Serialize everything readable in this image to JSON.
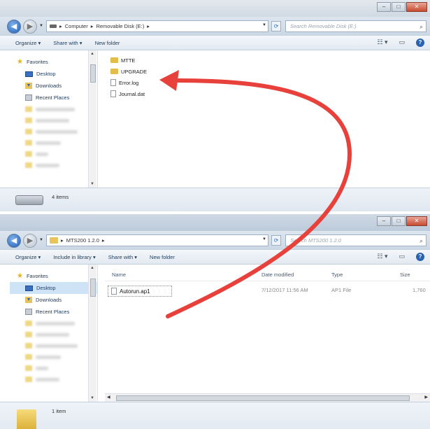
{
  "window1": {
    "address": {
      "segments": [
        "Computer",
        "Removable Disk (E:)"
      ]
    },
    "search_placeholder": "Search Removable Disk (E:)",
    "toolbar": {
      "organize": "Organize ▾",
      "share_with": "Share with ▾",
      "new_folder": "New folder"
    },
    "nav": {
      "favorites": "Favorites",
      "desktop": "Desktop",
      "downloads": "Downloads",
      "recent_places": "Recent Places"
    },
    "files": [
      {
        "name": "MTTE",
        "kind": "folder"
      },
      {
        "name": "UPGRADE",
        "kind": "folder"
      },
      {
        "name": "Error.log",
        "kind": "file"
      },
      {
        "name": "Journal.dat",
        "kind": "file"
      }
    ],
    "details": {
      "count": "4 items"
    }
  },
  "window2": {
    "address": {
      "segments": [
        "MTS200 1.2.0"
      ]
    },
    "search_placeholder": "Search MTS200 1.2.0",
    "toolbar": {
      "organize": "Organize ▾",
      "include_in_library": "Include in library ▾",
      "share_with": "Share with ▾",
      "new_folder": "New folder"
    },
    "nav": {
      "favorites": "Favorites",
      "desktop": "Desktop",
      "downloads": "Downloads",
      "recent_places": "Recent Places"
    },
    "columns": {
      "name": "Name",
      "date_modified": "Date modified",
      "type": "Type",
      "size": "Size"
    },
    "files": [
      {
        "name": "Autorun.ap1",
        "date_modified": "7/12/2017 11:56 AM",
        "type": "AP1 File",
        "size": "1,760"
      }
    ],
    "details": {
      "count": "1 item"
    }
  },
  "colors": {
    "arrow": "#e8403a",
    "accent": "#2a62b2"
  }
}
